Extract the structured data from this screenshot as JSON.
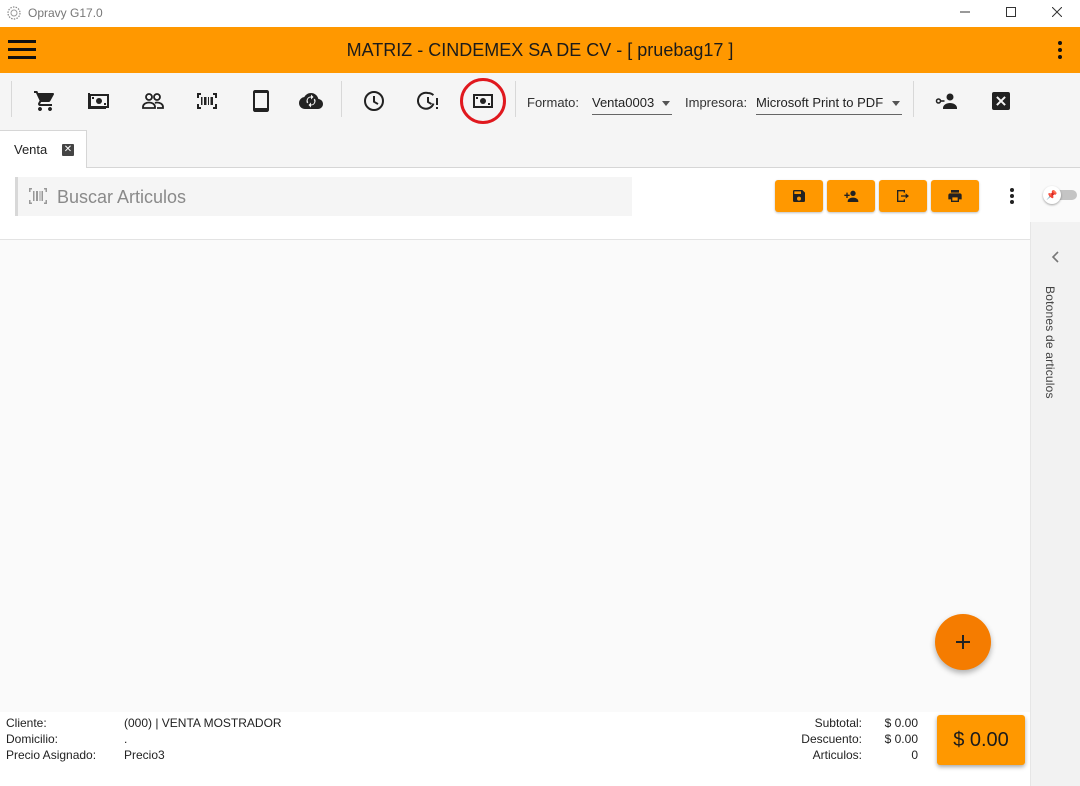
{
  "window": {
    "title": "Opravy G17.0"
  },
  "header": {
    "title": "MATRIZ - CINDEMEX SA DE CV - [ pruebag17 ]"
  },
  "toolbar": {
    "icons": [
      "cart-icon",
      "cash-icon",
      "users-icon",
      "barcode-icon",
      "tablet-icon",
      "cloud-sync-icon",
      "clock-icon",
      "clock-alert-icon",
      "money-icon",
      "user-key-icon",
      "close-box-icon"
    ],
    "highlighted": "money-icon",
    "formato_label": "Formato:",
    "formato_value": "Venta0003",
    "impresora_label": "Impresora:",
    "impresora_value": "Microsoft Print to PDF"
  },
  "tabs": [
    {
      "label": "Venta",
      "active": true
    }
  ],
  "search": {
    "placeholder": "Buscar Articulos"
  },
  "side_panel": {
    "label": "Botones de articulos"
  },
  "footer": {
    "cliente_label": "Cliente:",
    "cliente_value": "(000) | VENTA MOSTRADOR",
    "domicilio_label": "Domicilio:",
    "domicilio_value": ".",
    "precio_label": "Precio Asignado:",
    "precio_value": "Precio3",
    "subtotal_label": "Subtotal:",
    "subtotal_value": "$ 0.00",
    "descuento_label": "Descuento:",
    "descuento_value": "$ 0.00",
    "articulos_label": "Articulos:",
    "articulos_value": "0",
    "total": "$ 0.00"
  },
  "colors": {
    "accent": "#ff9800",
    "fab": "#f57c00",
    "highlight_ring": "#e0181e"
  }
}
